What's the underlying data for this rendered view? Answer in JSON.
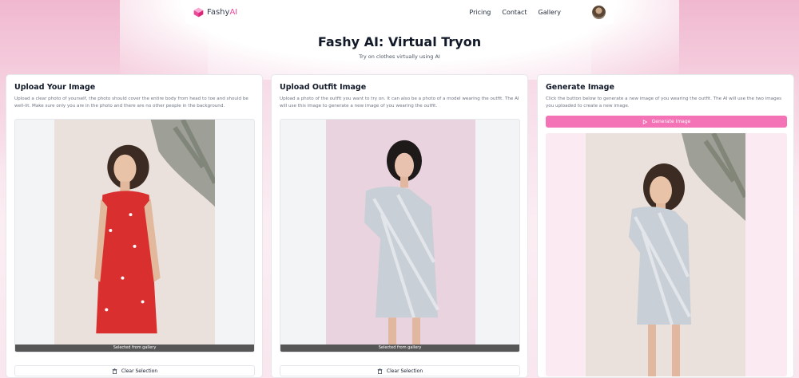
{
  "nav": {
    "logo_main": "Fashy",
    "logo_accent": "AI",
    "links": [
      "Pricing",
      "Contact",
      "Gallery"
    ]
  },
  "hero": {
    "title": "Fashy AI: Virtual Tryon",
    "subtitle": "Try on clothes virtually using AI"
  },
  "upload_image": {
    "title": "Upload Your Image",
    "description": "Upload a clear photo of yourself, the photo should cover the entire body from head to toe and should be well-lit. Make sure only you are in the photo and there are no other people in the background.",
    "status": "Selected from gallery",
    "clear_label": "Clear Selection"
  },
  "upload_outfit": {
    "title": "Upload Outfit Image",
    "description": "Upload a photo of the outfit you want to try on. It can also be a photo of a model wearing the outfit. The AI will use this image to generate a new image of you wearing the outfit.",
    "status": "Selected from gallery",
    "clear_label": "Clear Selection"
  },
  "generate": {
    "title": "Generate Image",
    "description": "Click the button below to generate a new image of you wearing the outfit. The AI will use the two images you uploaded to create a new image.",
    "button_label": "Generate Image"
  },
  "colors": {
    "accent": "#f472b6",
    "brand": "#ec4899"
  }
}
